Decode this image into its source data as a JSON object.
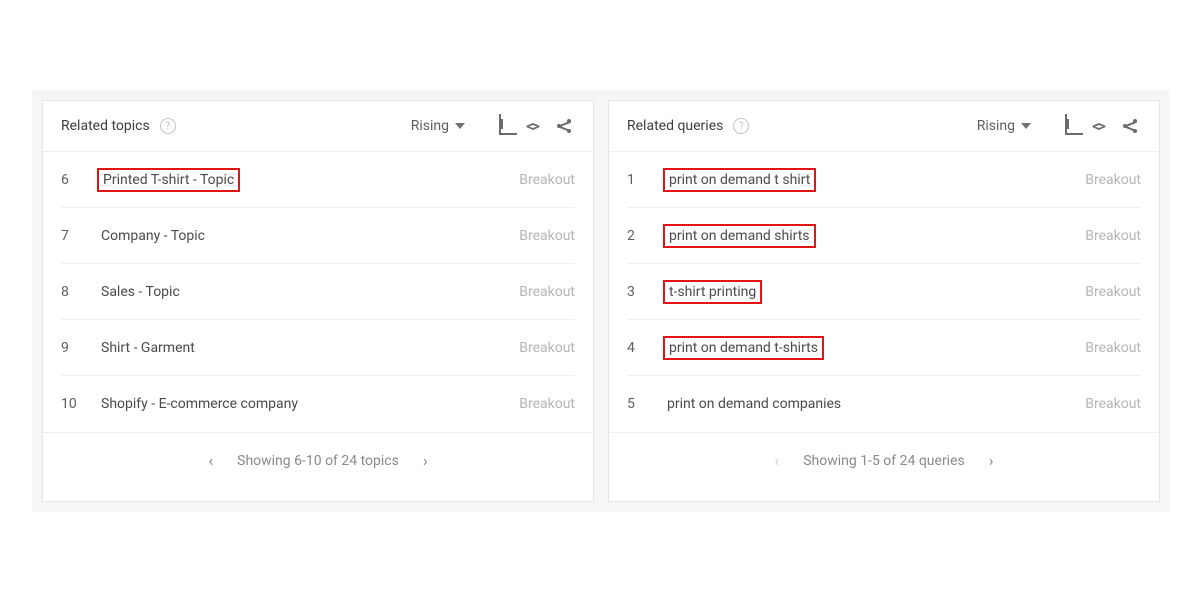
{
  "panels": [
    {
      "title": "Related topics",
      "sort_label": "Rising",
      "footer_text": "Showing 6-10 of 24 topics",
      "prev_disabled": false,
      "next_disabled": false,
      "rows": [
        {
          "rank": "6",
          "label": "Printed T-shirt - Topic",
          "value": "Breakout",
          "highlight": true
        },
        {
          "rank": "7",
          "label": "Company - Topic",
          "value": "Breakout",
          "highlight": false
        },
        {
          "rank": "8",
          "label": "Sales - Topic",
          "value": "Breakout",
          "highlight": false
        },
        {
          "rank": "9",
          "label": "Shirt - Garment",
          "value": "Breakout",
          "highlight": false
        },
        {
          "rank": "10",
          "label": "Shopify - E-commerce company",
          "value": "Breakout",
          "highlight": false
        }
      ]
    },
    {
      "title": "Related queries",
      "sort_label": "Rising",
      "footer_text": "Showing 1-5 of 24 queries",
      "prev_disabled": true,
      "next_disabled": false,
      "rows": [
        {
          "rank": "1",
          "label": "print on demand t shirt",
          "value": "Breakout",
          "highlight": true
        },
        {
          "rank": "2",
          "label": "print on demand shirts",
          "value": "Breakout",
          "highlight": true
        },
        {
          "rank": "3",
          "label": "t-shirt printing",
          "value": "Breakout",
          "highlight": true
        },
        {
          "rank": "4",
          "label": "print on demand t-shirts",
          "value": "Breakout",
          "highlight": true
        },
        {
          "rank": "5",
          "label": "print on demand companies",
          "value": "Breakout",
          "highlight": false
        }
      ]
    }
  ]
}
